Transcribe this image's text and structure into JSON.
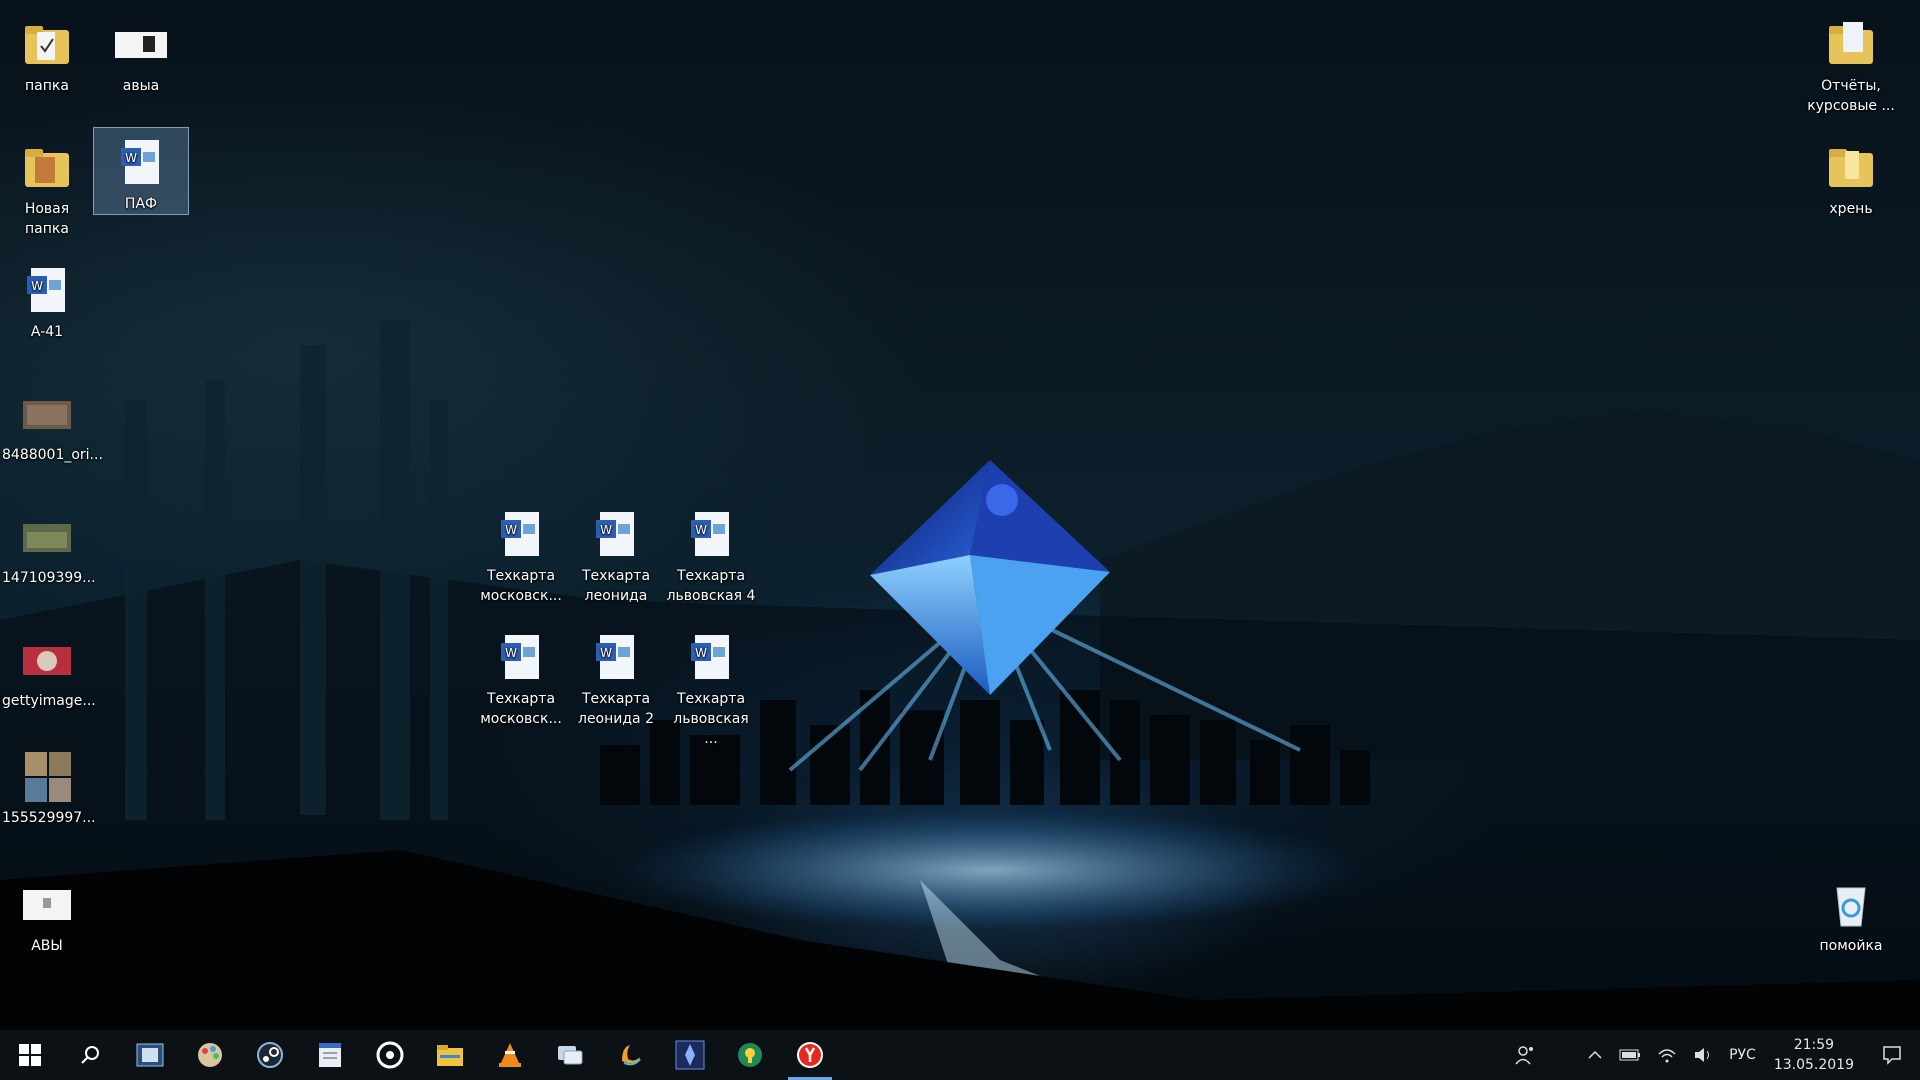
{
  "desktop": {
    "icons_left": [
      {
        "label": "папка",
        "icon": "folder-icon"
      },
      {
        "label": "Новая папка",
        "icon": "folder-icon"
      },
      {
        "label": "A-41",
        "icon": "word-document-icon"
      },
      {
        "label": "8488001_ori...",
        "icon": "image-file-icon"
      },
      {
        "label": "147109399...",
        "icon": "image-file-icon"
      },
      {
        "label": "gettyimage...",
        "icon": "image-file-icon"
      },
      {
        "label": "155529997...",
        "icon": "image-file-icon"
      },
      {
        "label": "АВЫ",
        "icon": "image-file-icon"
      }
    ],
    "icons_col2": [
      {
        "label": "авыа",
        "icon": "image-file-icon"
      },
      {
        "label": "ПАФ",
        "icon": "word-document-icon",
        "selected": true
      }
    ],
    "icons_center": [
      {
        "label": "Техкарта московск...",
        "icon": "word-document-icon"
      },
      {
        "label": "Техкарта леонида",
        "icon": "word-document-icon"
      },
      {
        "label": "Техкарта львовская 4",
        "icon": "word-document-icon"
      },
      {
        "label": "Техкарта московск...",
        "icon": "word-document-icon"
      },
      {
        "label": "Техкарта леонида 2",
        "icon": "word-document-icon"
      },
      {
        "label": "Техкарта львовская ...",
        "icon": "word-document-icon"
      }
    ],
    "icons_right": [
      {
        "label": "Отчёты, курсовые ...",
        "icon": "folder-icon"
      },
      {
        "label": "хрень",
        "icon": "folder-icon"
      },
      {
        "label": "помойка",
        "icon": "recycle-bin-icon"
      }
    ]
  },
  "taskbar": {
    "apps": [
      {
        "name": "start",
        "icon": "windows-start-icon"
      },
      {
        "name": "search",
        "icon": "search-icon"
      },
      {
        "name": "task-view",
        "icon": "film-icon"
      },
      {
        "name": "app-paint",
        "icon": "palette-icon"
      },
      {
        "name": "steam",
        "icon": "steam-icon"
      },
      {
        "name": "notepad",
        "icon": "notepad-icon"
      },
      {
        "name": "media",
        "icon": "disc-icon"
      },
      {
        "name": "file-explorer",
        "icon": "folder-icon"
      },
      {
        "name": "vlc",
        "icon": "vlc-icon"
      },
      {
        "name": "chat",
        "icon": "chat-icon"
      },
      {
        "name": "app-swoosh",
        "icon": "swoosh-icon"
      },
      {
        "name": "app-game",
        "icon": "game-icon"
      },
      {
        "name": "app-globe",
        "icon": "globe-icon"
      },
      {
        "name": "yandex-browser",
        "icon": "yandex-icon",
        "active": true
      }
    ],
    "tray": {
      "language": "РУС",
      "time": "21:59",
      "date": "13.05.2019"
    }
  },
  "colors": {
    "taskbar_bg": "#0c1115",
    "active_indicator": "#6aa8e6",
    "selection_bg": "#7aa0c8"
  }
}
